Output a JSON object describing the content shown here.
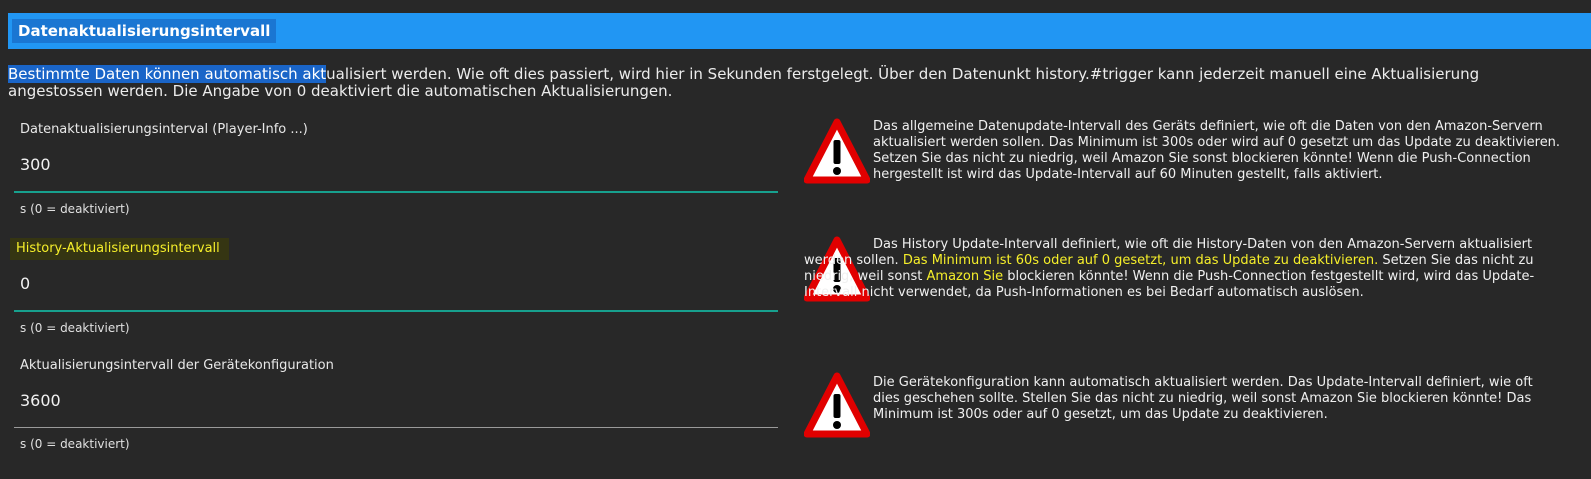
{
  "section": {
    "title": "Datenaktualisierungsintervall",
    "intro_selected": "Bestimmte Daten können automatisch akt",
    "intro_rest": "ualisiert werden. Wie oft dies passiert, wird hier in Sekunden ferstgelegt. Über den Datenunkt history.#trigger kann jederzeit manuell eine Aktualisierung angestossen werden. Die Angabe von 0 deaktiviert die automatischen Aktualisierungen."
  },
  "fields": [
    {
      "label": "Datenaktualisierungsinterval (Player-Info ...)",
      "value": "300",
      "hint": "s (0 = deaktiviert)",
      "warning": "Das allgemeine Datenupdate-Intervall des Geräts definiert, wie oft die Daten von den Amazon-Servern aktualisiert werden sollen. Das Minimum ist 300s oder wird auf 0 gesetzt um das Update zu deaktivieren. Setzen Sie das nicht zu niedrig, weil Amazon Sie sonst blockieren könnte! Wenn die Push-Connection hergestellt ist wird das Update-Intervall auf 60 Minuten gestellt, falls aktiviert."
    },
    {
      "label": "History-Aktualisierungsintervall",
      "value": "0",
      "hint": "s (0 = deaktiviert)",
      "warning_part1": "Das History Update-Intervall definiert, wie oft die History-Daten von den Amazon-Servern aktualisiert werden sollen. ",
      "warning_highlight1": "Das Minimum ist 60s oder auf 0 gesetzt, um das Update zu deaktivieren.",
      "warning_part2": " Setzen Sie das nicht zu niedrig, weil sonst ",
      "warning_highlight2": "Amazon Sie",
      "warning_part3": " blockieren könnte! Wenn die Push-Connection festgestellt wird, wird das Update-Intervall nicht verwendet, da Push-Informationen es bei Bedarf automatisch auslösen."
    },
    {
      "label": "Aktualisierungsintervall der Gerätekonfiguration",
      "value": "3600",
      "hint": "s (0 = deaktiviert)",
      "warning": "Die Gerätekonfiguration kann automatisch aktualisiert werden. Das Update-Intervall definiert, wie oft dies geschehen sollte. Stellen Sie das nicht zu niedrig, weil sonst Amazon Sie blockieren könnte! Das Minimum ist 300s oder auf 0 gesetzt, um das Update zu deaktivieren."
    }
  ],
  "icons": {
    "warning": "warning-icon"
  },
  "colors": {
    "header": "#2196f3",
    "selection": "#1a65c8",
    "focus_label": "#f6ef2a",
    "underline_active": "#17a08e",
    "warning_red": "#e10000"
  }
}
